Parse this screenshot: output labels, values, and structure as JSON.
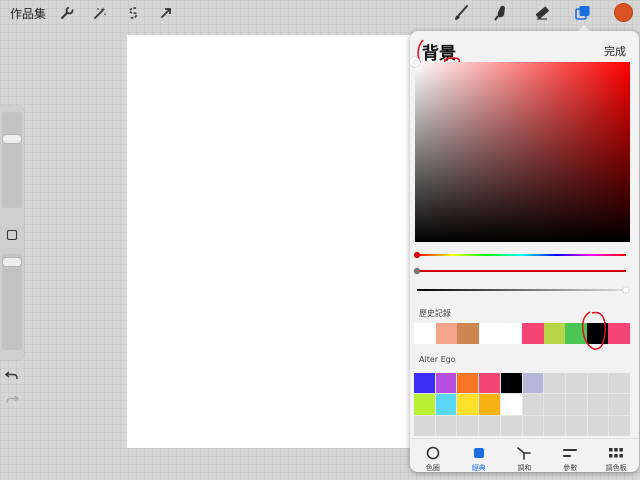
{
  "topbar": {
    "gallery_label": "作品集",
    "icons": [
      "wrench-icon",
      "magic-wand-icon",
      "selection-icon",
      "transform-icon",
      "brush-icon",
      "smudge-icon",
      "eraser-icon",
      "layers-icon"
    ],
    "current_color": "#d85424"
  },
  "color_panel": {
    "title": "背景",
    "done_label": "完成",
    "current_color": "#ff0000",
    "history_label": "歷史記錄",
    "history_colors": [
      "#ffffff",
      "#f4a58c",
      "#cd8651",
      "#ffffff",
      "#ffffff",
      "#f34473",
      "#b8d447",
      "#4cc456",
      "#000000",
      "#f34473"
    ],
    "palette_label": "Alter Ego",
    "palette_colors": [
      "#3a2df4",
      "#b64ee0",
      "#f97423",
      "#f34473",
      "#000000",
      "#b7b6d8",
      "",
      "",
      "",
      "",
      "#b8f034",
      "#5ad6f6",
      "#fde02a",
      "#f8b112",
      "#ffffff",
      "",
      "",
      "",
      "",
      "",
      "",
      "",
      "",
      "",
      "",
      "",
      "",
      "",
      "",
      ""
    ],
    "tabs": [
      {
        "label": "色圈",
        "icon": "disc-icon",
        "active": false
      },
      {
        "label": "經典",
        "icon": "classic-square-icon",
        "active": true
      },
      {
        "label": "調和",
        "icon": "harmony-icon",
        "active": false
      },
      {
        "label": "參數",
        "icon": "value-bars-icon",
        "active": false
      },
      {
        "label": "調色板",
        "icon": "palette-grid-icon",
        "active": false
      }
    ]
  }
}
